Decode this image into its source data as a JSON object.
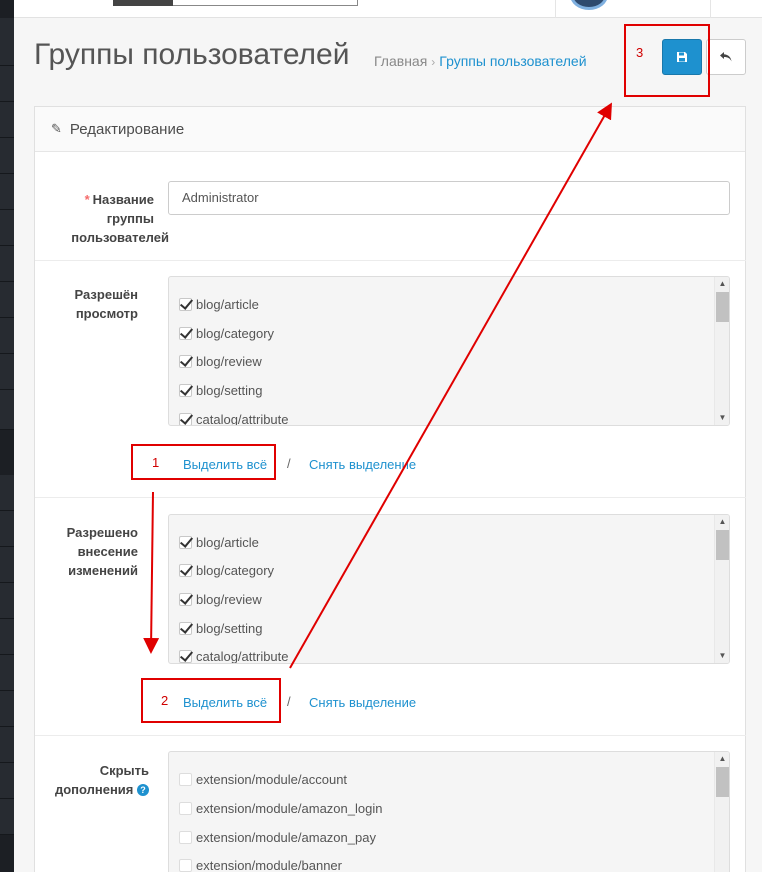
{
  "page": {
    "title": "Группы пользователей",
    "breadcrumb": {
      "home": "Главная",
      "separator": "›",
      "current": "Группы пользователей"
    }
  },
  "panel": {
    "heading": "Редактирование"
  },
  "form": {
    "name_label": {
      "req": "*",
      "line1": "Название",
      "line2": "группы",
      "line3": "пользователей"
    },
    "name_value": "Administrator",
    "access": {
      "label_line1": "Разрешён",
      "label_line2": "просмотр",
      "items": [
        "blog/article",
        "blog/category",
        "blog/review",
        "blog/setting",
        "catalog/attribute"
      ],
      "select_all": "Выделить всё",
      "slash": "/",
      "unselect": "Снять выделение"
    },
    "modify": {
      "label_line1": "Разрешено",
      "label_line2": "внесение",
      "label_line3": "изменений",
      "items": [
        "blog/article",
        "blog/category",
        "blog/review",
        "blog/setting",
        "catalog/attribute"
      ],
      "select_all": "Выделить всё",
      "slash": "/",
      "unselect": "Снять выделение"
    },
    "hide": {
      "label_line1": "Скрыть",
      "label_line2": "дополнения",
      "help": "?",
      "items": [
        "extension/module/account",
        "extension/module/amazon_login",
        "extension/module/amazon_pay",
        "extension/module/banner"
      ]
    }
  },
  "annotations": {
    "n1": "1",
    "n2": "2",
    "n3": "3"
  },
  "colors": {
    "accent": "#1e91cf",
    "annotation": "#e00000"
  }
}
